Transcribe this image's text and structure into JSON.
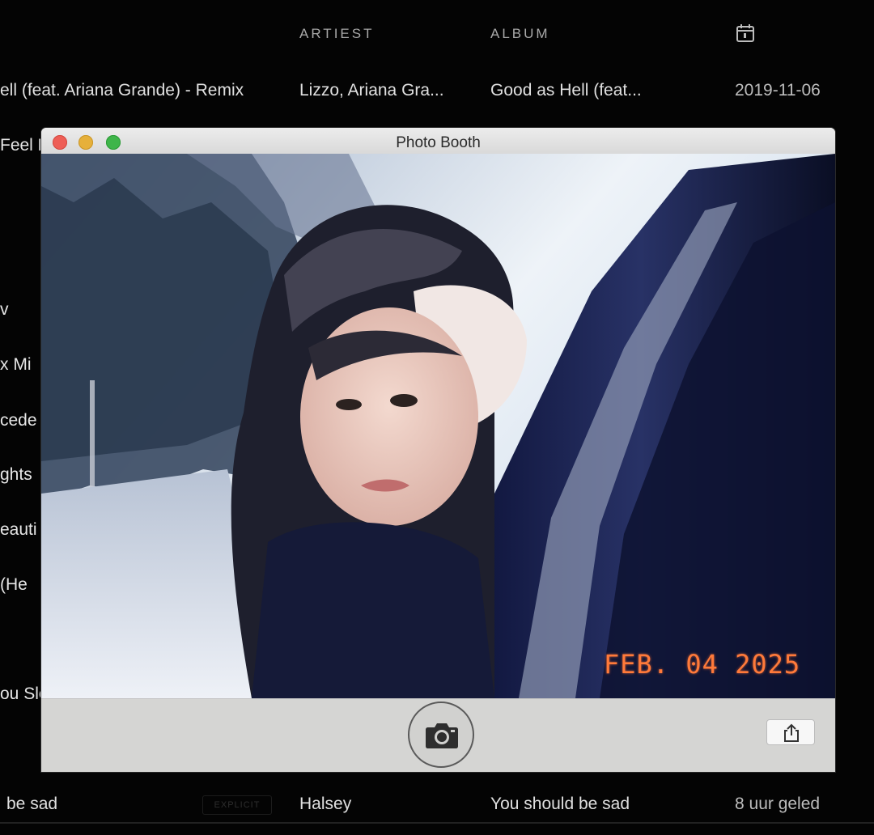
{
  "list": {
    "headers": {
      "artist": "ARTIEST",
      "album": "ALBUM",
      "date_icon": "calendar-icon"
    },
    "top_row": {
      "title": "ell (feat. Ariana Grande) - Remix",
      "artist": "Lizzo, Ariana Gra...",
      "album": "Good as Hell (feat...",
      "date": "2019-11-06"
    },
    "partial_titles": [
      "Feel E",
      "v",
      "x Mi",
      "cede",
      "ghts",
      "eauti",
      "(He",
      "ou Sle"
    ],
    "bottom_row": {
      "title": "be sad",
      "badge": "EXPLICIT",
      "artist": "Halsey",
      "album": "You should be sad",
      "date": "8 uur geled"
    }
  },
  "photobooth": {
    "title": "Photo Booth",
    "date_stamp": "FEB. 04 2025",
    "shutter_icon": "camera-icon",
    "share_icon": "share-icon",
    "colors": {
      "close": "#ee5e56",
      "minimize": "#e6b03a",
      "maximize": "#3fb54a",
      "stamp": "#ff7a3a"
    }
  }
}
